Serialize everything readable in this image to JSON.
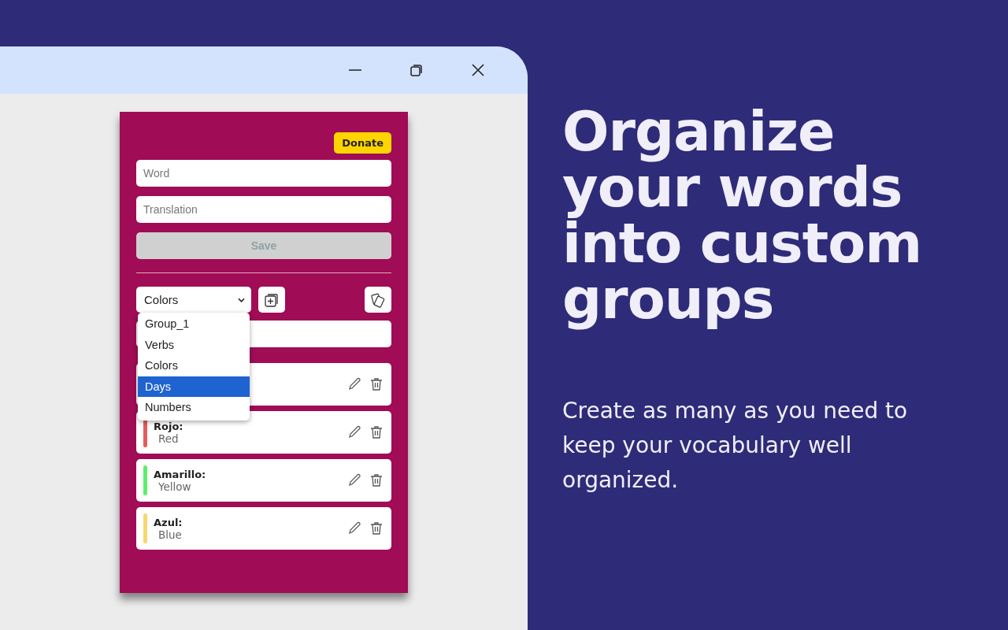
{
  "popup": {
    "donate": "Donate",
    "word_field": {
      "placeholder": "Word"
    },
    "translation_field": {
      "placeholder": "Translation"
    },
    "save": {
      "label": "Save",
      "disabled": true
    },
    "group_select": {
      "value": "Colors",
      "options": [
        {
          "label": "Group_1",
          "highlighted": false
        },
        {
          "label": "Verbs",
          "highlighted": false
        },
        {
          "label": "Colors",
          "highlighted": false
        },
        {
          "label": "Days",
          "highlighted": true
        },
        {
          "label": "Numbers",
          "highlighted": false
        }
      ]
    },
    "words": [
      {
        "hidden": true
      },
      {
        "word": "Rojo:",
        "translation": "Red",
        "color": "#e25c5c"
      },
      {
        "word": "Amarillo:",
        "translation": "Yellow",
        "color": "#5fee6c"
      },
      {
        "word": "Azul:",
        "translation": "Blue",
        "color": "#f6d86c"
      }
    ]
  },
  "headline": "Organize your words into custom groups",
  "description": "Create as many as you need to keep your vocabulary well organized."
}
